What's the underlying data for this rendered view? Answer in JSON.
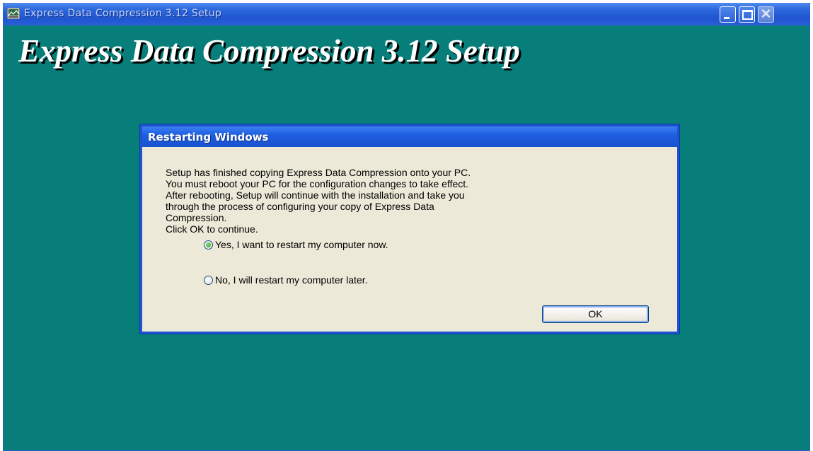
{
  "window": {
    "title": "Express Data Compression 3.12 Setup",
    "banner": "Express Data Compression 3.12 Setup",
    "background_color": "#087e7a"
  },
  "dialog": {
    "title": "Restarting Windows",
    "message_lines": [
      "Setup has finished copying Express Data Compression onto your PC.",
      "You must reboot your PC for the configuration changes to take effect.",
      "After rebooting, Setup will continue with the installation and take you",
      "through the process of configuring your copy of Express Data",
      "Compression.",
      "Click OK to continue."
    ],
    "options": [
      {
        "label": "Yes, I want to restart my computer now.",
        "selected": true
      },
      {
        "label": "No, I will restart my computer later.",
        "selected": false
      }
    ],
    "ok_label": "OK"
  }
}
